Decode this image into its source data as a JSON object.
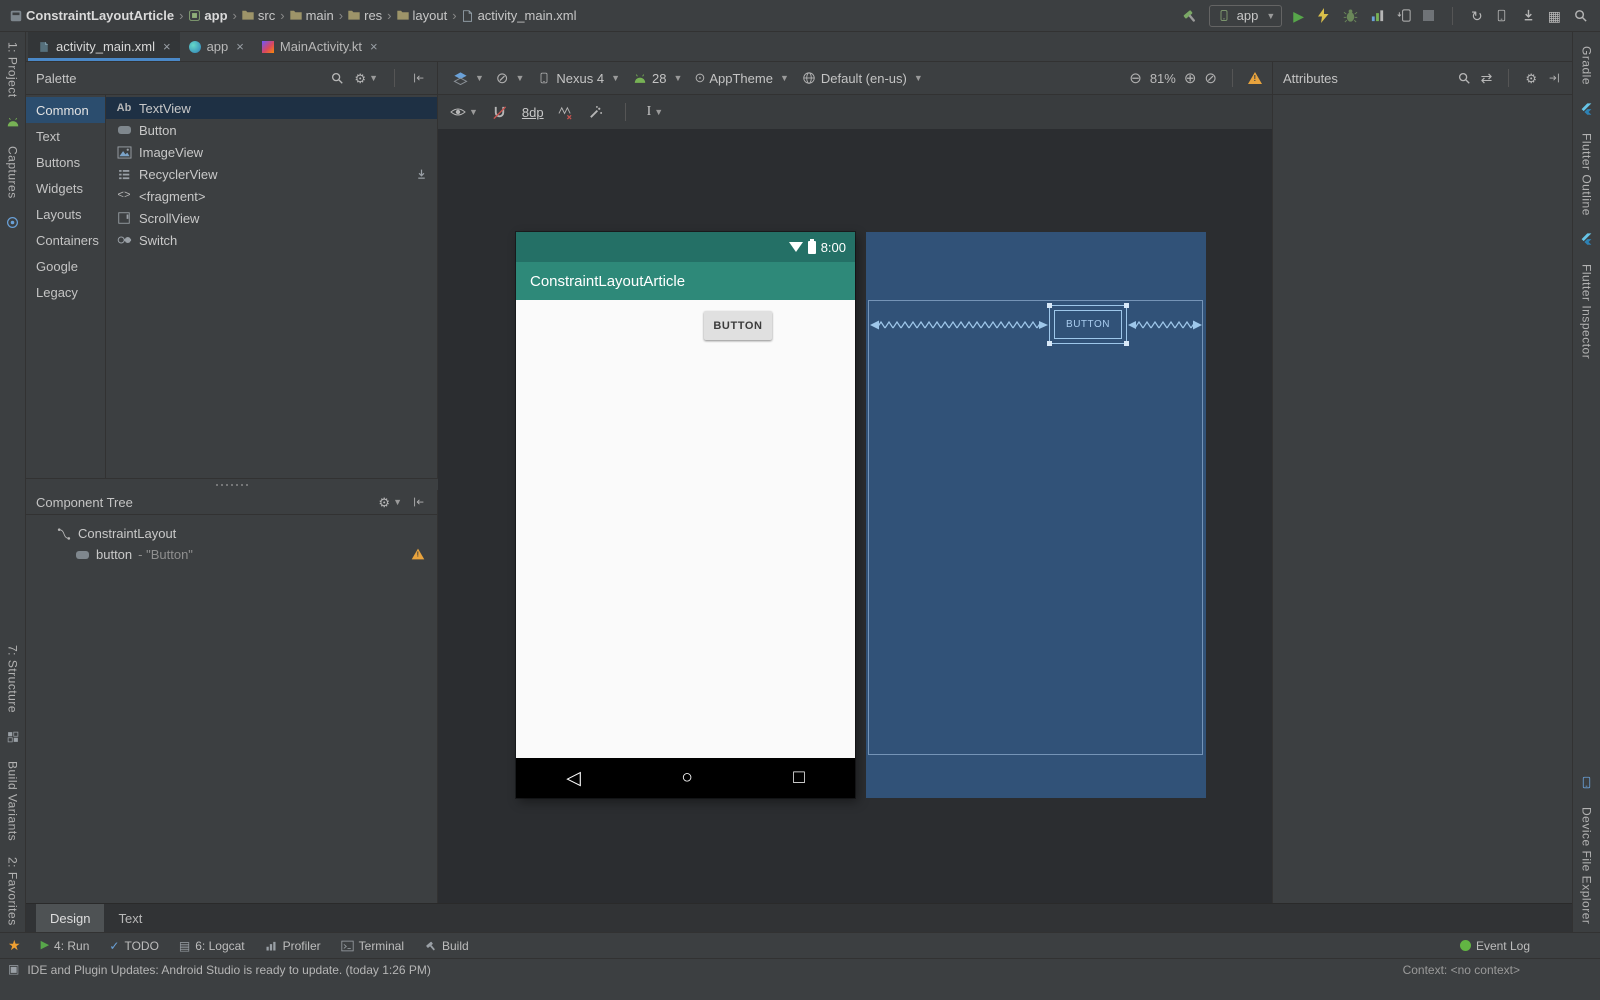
{
  "breadcrumb": {
    "separator": "›",
    "items": [
      "ConstraintLayoutArticle",
      "app",
      "src",
      "main",
      "res",
      "layout",
      "activity_main.xml"
    ]
  },
  "top_toolbar": {
    "run_config": "app"
  },
  "editor_tabs": [
    {
      "label": "activity_main.xml"
    },
    {
      "label": "app"
    },
    {
      "label": "MainActivity.kt"
    }
  ],
  "left_stripe": {
    "project": "1: Project",
    "captures": "Captures",
    "structure": "7: Structure",
    "build_variants": "Build Variants",
    "favorites": "2: Favorites"
  },
  "right_stripe": {
    "gradle": "Gradle",
    "flutter_outline": "Flutter Outline",
    "flutter_inspector": "Flutter Inspector",
    "device_file_explorer": "Device File Explorer"
  },
  "palette": {
    "title": "Palette",
    "categories": [
      "Common",
      "Text",
      "Buttons",
      "Widgets",
      "Layouts",
      "Containers",
      "Google",
      "Legacy"
    ],
    "components": [
      "TextView",
      "Button",
      "ImageView",
      "RecyclerView",
      "<fragment>",
      "ScrollView",
      "Switch"
    ]
  },
  "component_tree": {
    "title": "Component Tree",
    "root_label": "ConstraintLayout",
    "child_label": "button",
    "child_suffix": "- \"Button\""
  },
  "design_toolbar": {
    "device": "Nexus 4",
    "api_level": "28",
    "theme": "AppTheme",
    "locale": "Default (en-us)",
    "zoom": "81%"
  },
  "surface_toolbar": {
    "default_margin": "8dp"
  },
  "attributes_panel": {
    "title": "Attributes"
  },
  "device_preview": {
    "status_time": "8:00",
    "app_title": "ConstraintLayoutArticle",
    "button_label": "BUTTON"
  },
  "blueprint_preview": {
    "button_label": "BUTTON"
  },
  "mode_tabs": {
    "design": "Design",
    "text": "Text"
  },
  "bottom_toolbar": {
    "run": "4: Run",
    "todo": "TODO",
    "logcat": "6: Logcat",
    "profiler": "Profiler",
    "terminal": "Terminal",
    "build": "Build",
    "event_log": "Event Log"
  },
  "status_bar": {
    "message": "IDE and Plugin Updates: Android Studio is ready to update. (today 1:26 PM)",
    "context": "Context: <no context>"
  }
}
